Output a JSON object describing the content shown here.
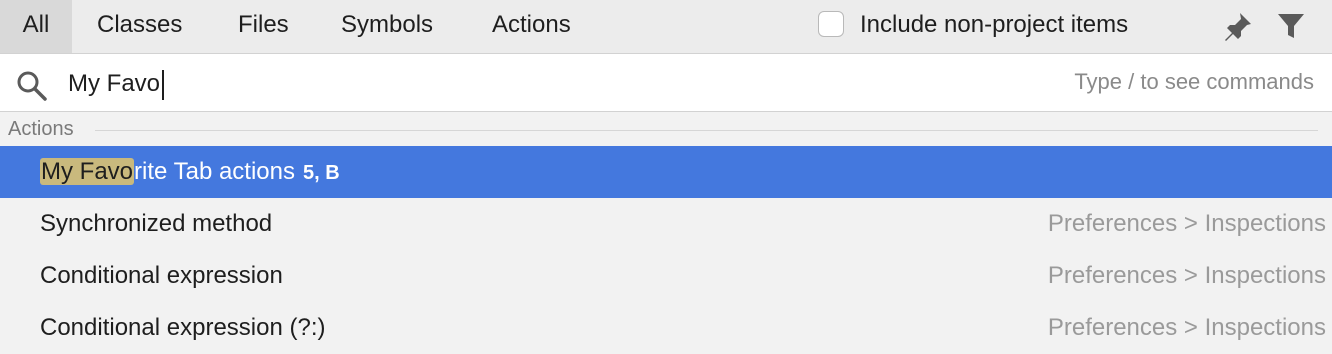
{
  "tabs": [
    {
      "label": "All",
      "active": true
    },
    {
      "label": "Classes"
    },
    {
      "label": "Files"
    },
    {
      "label": "Symbols"
    },
    {
      "label": "Actions"
    }
  ],
  "include_option": {
    "label": "Include non-project items",
    "checked": false
  },
  "icons": {
    "pin": "pin-icon",
    "filter": "filter-icon",
    "search": "search-icon"
  },
  "search": {
    "value": "My Favo",
    "hint": "Type / to see commands"
  },
  "section": {
    "label": "Actions"
  },
  "results": [
    {
      "match": "My Favo",
      "rest": "rite Tab actions",
      "shortcut": "5, B",
      "location": "",
      "selected": true
    },
    {
      "label": "Synchronized method",
      "location": "Preferences > Inspections"
    },
    {
      "label": "Conditional expression",
      "location": "Preferences > Inspections"
    },
    {
      "label": "Conditional expression (?:)",
      "location": "Preferences > Inspections"
    }
  ],
  "colors": {
    "selection": "#4478de",
    "match_highlight": "#c9b97d",
    "background": "#f2f2f2"
  }
}
